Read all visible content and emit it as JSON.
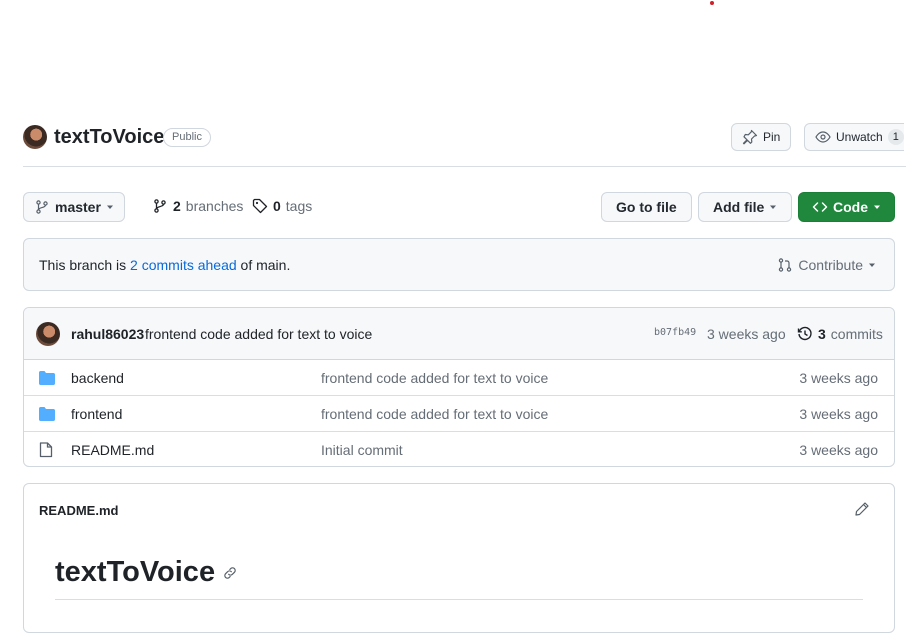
{
  "repo": {
    "name": "textToVoice",
    "visibility": "Public",
    "pin_label": "Pin",
    "unwatch_label": "Unwatch",
    "watch_count": "1"
  },
  "branch_bar": {
    "branch_name": "master",
    "branches_count": "2",
    "branches_label": "branches",
    "tags_count": "0",
    "tags_label": "tags",
    "go_to_file_label": "Go to file",
    "add_file_label": "Add file",
    "code_label": "Code"
  },
  "ahead": {
    "prefix": "This branch is ",
    "link_text": "2 commits ahead",
    "suffix": " of main.",
    "contribute_label": "Contribute"
  },
  "latest_commit": {
    "author": "rahul86023",
    "message": "frontend code added for text to voice",
    "sha": "b07fb49",
    "time": "3 weeks ago",
    "commits_count": "3",
    "commits_label": "commits"
  },
  "files": [
    {
      "type": "folder",
      "name": "backend",
      "message": "frontend code added for text to voice",
      "time": "3 weeks ago"
    },
    {
      "type": "folder",
      "name": "frontend",
      "message": "frontend code added for text to voice",
      "time": "3 weeks ago"
    },
    {
      "type": "file",
      "name": "README.md",
      "message": "Initial commit",
      "time": "3 weeks ago"
    }
  ],
  "readme": {
    "file_label": "README.md",
    "heading": "textToVoice"
  },
  "colors": {
    "accent_link": "#0969da",
    "code_button": "#1f883d",
    "folder_icon": "#54aeff"
  }
}
